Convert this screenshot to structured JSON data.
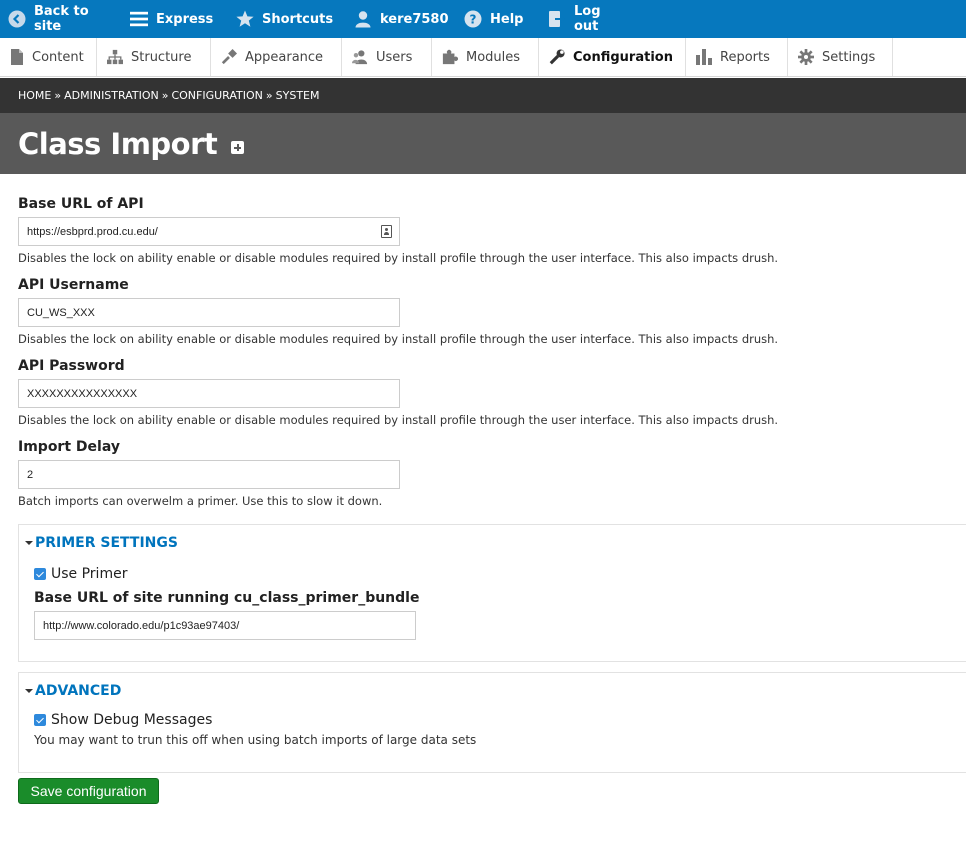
{
  "toolbar": {
    "items": [
      {
        "label": "Back to site",
        "icon": "back-arrow-icon"
      },
      {
        "label": "Express",
        "icon": "menu-icon"
      },
      {
        "label": "Shortcuts",
        "icon": "star-icon"
      },
      {
        "label": "kere7580",
        "icon": "user-icon"
      },
      {
        "label": "Help",
        "icon": "help-icon"
      },
      {
        "label": "Log out",
        "icon": "logout-icon"
      }
    ]
  },
  "tray": {
    "items": [
      {
        "label": "Content",
        "icon": "document-icon"
      },
      {
        "label": "Structure",
        "icon": "sitemap-icon"
      },
      {
        "label": "Appearance",
        "icon": "paintbrush-icon"
      },
      {
        "label": "Users",
        "icon": "people-icon"
      },
      {
        "label": "Modules",
        "icon": "puzzle-icon"
      },
      {
        "label": "Configuration",
        "icon": "wrench-icon"
      },
      {
        "label": "Reports",
        "icon": "bar-chart-icon"
      },
      {
        "label": "Settings",
        "icon": "gear-icon"
      }
    ],
    "active": "Configuration"
  },
  "breadcrumb": {
    "items": [
      "HOME",
      "ADMINISTRATION",
      "CONFIGURATION",
      "SYSTEM"
    ],
    "separator": "»"
  },
  "page": {
    "title": "Class Import"
  },
  "form": {
    "base_url": {
      "label": "Base URL of API",
      "value": "https://esbprd.prod.cu.edu/",
      "description": "Disables the lock on ability enable or disable modules required by install profile through the user interface. This also impacts drush."
    },
    "api_username": {
      "label": "API Username",
      "value": "CU_WS_XXX",
      "description": "Disables the lock on ability enable or disable modules required by install profile through the user interface. This also impacts drush."
    },
    "api_password": {
      "label": "API Password",
      "value": "XXXXXXXXXXXXXXX",
      "description": "Disables the lock on ability enable or disable modules required by install profile through the user interface. This also impacts drush."
    },
    "import_delay": {
      "label": "Import Delay",
      "value": "2",
      "description": "Batch imports can overwelm a primer. Use this to slow it down."
    },
    "primer_settings": {
      "legend": "PRIMER SETTINGS",
      "use_primer_label": "Use Primer",
      "use_primer_checked": true,
      "primer_url_label": "Base URL of site running cu_class_primer_bundle",
      "primer_url_value": "http://www.colorado.edu/p1c93ae97403/"
    },
    "advanced": {
      "legend": "ADVANCED",
      "debug_label": "Show Debug Messages",
      "debug_checked": true,
      "debug_description": "You may want to trun this off when using batch imports of large data sets"
    },
    "save_label": "Save configuration"
  },
  "colors": {
    "toolbar": "#0678be",
    "breadcrumb_bg": "#333333",
    "title_band": "#595959",
    "legend_link": "#0074bd",
    "save_button": "#1a8c2a",
    "checkbox": "#2e89dc"
  }
}
